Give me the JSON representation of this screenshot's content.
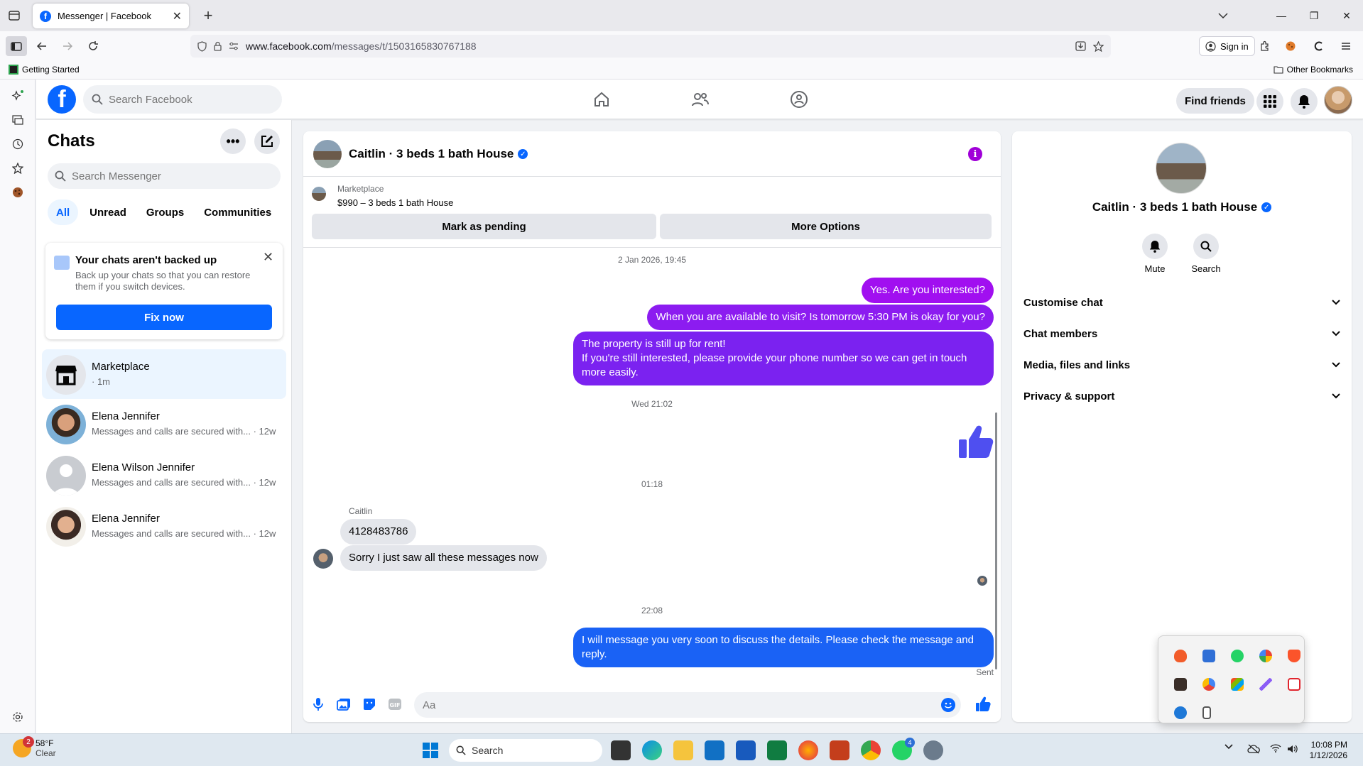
{
  "browser": {
    "tab_title": "Messenger | Facebook",
    "url_host": "www.facebook.com",
    "url_path": "/messages/t/1503165830767188",
    "sign_in": "Sign in",
    "bookmark_left": "Getting Started",
    "bookmark_right": "Other Bookmarks"
  },
  "fb_header": {
    "logo": "f",
    "search_placeholder": "Search Facebook",
    "find_friends": "Find friends"
  },
  "chats": {
    "title": "Chats",
    "more": "•••",
    "search_placeholder": "Search Messenger",
    "filters": [
      "All",
      "Unread",
      "Groups",
      "Communities"
    ],
    "backup": {
      "title": "Your chats aren't backed up",
      "desc": "Back up your chats so that you can restore them if you switch devices.",
      "button": "Fix now"
    },
    "items": [
      {
        "name": "Marketplace",
        "preview": "· 1m"
      },
      {
        "name": "Elena Jennifer",
        "preview": "Messages and calls are secured with... · 12w"
      },
      {
        "name": "Elena Wilson Jennifer",
        "preview": "Messages and calls are secured with... · 12w"
      },
      {
        "name": "Elena Jennifer",
        "preview": "Messages and calls are secured with... · 12w"
      }
    ]
  },
  "conversation": {
    "title": "Caitlin · 3 beds 1 bath House",
    "marketplace_label": "Marketplace",
    "listing": "$990 – 3 beds 1 bath House",
    "mark_pending": "Mark as pending",
    "more_options": "More Options",
    "time1": "2 Jan 2026, 19:45",
    "msg1": "Yes. Are you interested?",
    "msg2": "When you are available to visit? Is tomorrow 5:30 PM is okay for you?",
    "msg3a": "The property is still up for rent!",
    "msg3b": "If you're still interested, please provide your phone number so we can get in touch more easily.",
    "time2": "Wed 21:02",
    "time3": "01:18",
    "sender": "Caitlin",
    "in1": "4128483786",
    "in2": "Sorry I just saw all these messages now",
    "time4": "22:08",
    "msg4": "I will message you very soon to discuss the details. Please check the message and reply.",
    "sent": "Sent",
    "composer_placeholder": "Aa"
  },
  "details": {
    "name": "Caitlin · 3 beds 1 bath House",
    "actions": [
      "Mute",
      "Search"
    ],
    "sections": [
      "Customise chat",
      "Chat members",
      "Media, files and links",
      "Privacy & support"
    ]
  },
  "taskbar": {
    "weather_temp": "58°F",
    "weather_desc": "Clear",
    "weather_badge": "2",
    "search": "Search",
    "time": "10:08 PM",
    "date": "1/12/2026",
    "whatsapp_badge": "4"
  },
  "colors": {
    "facebook_blue": "#0866ff",
    "bubble_purple": "#a10ff0",
    "bubble_violet": "#8c1cf0",
    "bubble_mid": "#7b22f0",
    "bubble_blue": "#1a62f5",
    "thumb_blue": "#4f4ff0"
  }
}
